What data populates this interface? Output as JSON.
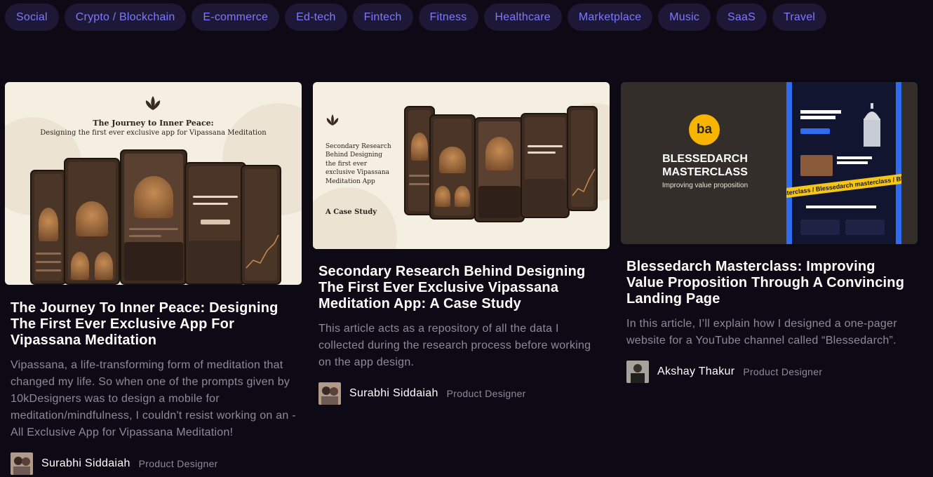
{
  "tags": [
    "Social",
    "Crypto / Blockchain",
    "E-commerce",
    "Ed-tech",
    "Fintech",
    "Fitness",
    "Healthcare",
    "Marketplace",
    "Music",
    "SaaS",
    "Travel"
  ],
  "colors": {
    "page_background": "#0d0a16",
    "tag_background": "#1c1836",
    "tag_text": "#7e78ff",
    "muted_text": "#8d8a99",
    "accent_yellow": "#f7b500",
    "accent_blue": "#2f6cf0"
  },
  "cards": [
    {
      "thumbnail": {
        "icon": "lotus-icon",
        "heading": "The Journey to Inner Peace:",
        "subheading": "Designing the first ever exclusive app for Vipassana Meditation"
      },
      "title": "The Journey To Inner Peace: Designing The First Ever Exclusive App For Vipassana Meditation",
      "excerpt": "Vipassana, a life-transforming form of meditation that changed my life. So when one of the prompts given by 10kDesigners was to design a mobile for meditation/mindfulness, I couldn't resist working on an - All Exclusive App for Vipassana Meditation!",
      "author": {
        "name": "Surabhi Siddaiah",
        "role": "Product Designer"
      }
    },
    {
      "thumbnail": {
        "icon": "lotus-icon",
        "heading": "Secondary Research Behind Designing the first ever exclusive Vipassana Meditation App",
        "subheading": "A Case Study"
      },
      "title": "Secondary Research Behind Designing The First Ever Exclusive Vipassana Meditation App: A Case Study",
      "excerpt": "This article acts as a repository of all the data I collected during the research process before working on the app design.",
      "author": {
        "name": "Surabhi Siddaiah",
        "role": "Product Designer"
      }
    },
    {
      "thumbnail": {
        "logo": "ba",
        "heading": "BLESSEDARCH MASTERCLASS",
        "subheading": "Improving value proposition",
        "strip": "asterclass / Blessedarch masterclass / Blessedarch m"
      },
      "title": "Blessedarch Masterclass: Improving Value Proposition Through A Convincing Landing Page",
      "excerpt": "In this article, I’ll explain how I designed a one-pager website for a YouTube channel called “Blessedarch”.",
      "author": {
        "name": "Akshay Thakur",
        "role": "Product Designer"
      }
    }
  ]
}
